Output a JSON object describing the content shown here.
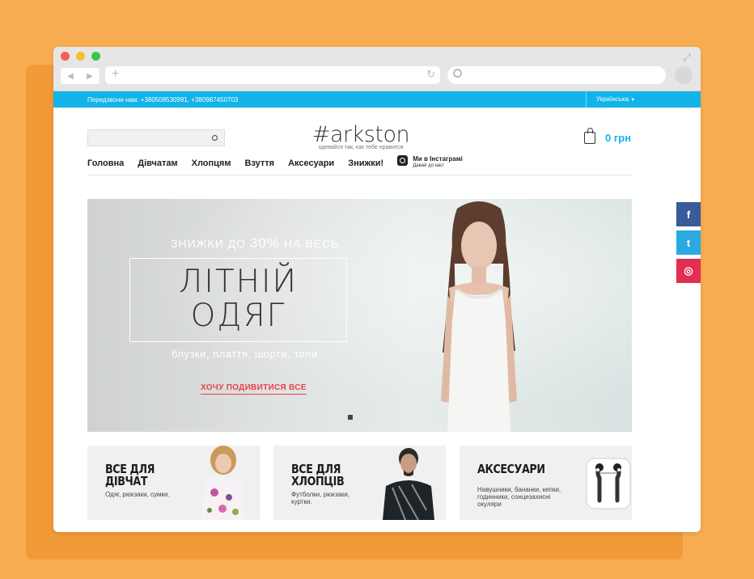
{
  "browser": {
    "url": "",
    "search_placeholder": ""
  },
  "topbar": {
    "phones": "Передзвони нам: +380508530991, +380987450703",
    "language": "Українська"
  },
  "header": {
    "search_placeholder": "",
    "logo_text": "#arkston",
    "tagline": "одевайся так, как тебе нравится",
    "cart_total": "0 грн"
  },
  "nav": {
    "items": [
      "Головна",
      "Дівчатам",
      "Хлопцям",
      "Взуття",
      "Аксесуари",
      "Знижки!"
    ],
    "instagram_title": "Ми в Інстаграмі",
    "instagram_sub": "Давай до нас!"
  },
  "hero": {
    "promo_prefix": "ЗНИЖКИ ДО",
    "promo_percent": "30%",
    "promo_suffix": "НА ВЕСЬ",
    "headline_line1": "ЛІТНІЙ",
    "headline_line2": "ОДЯГ",
    "subline": "блузки, плаття, шорти, топи",
    "cta": "ХОЧУ ПОДИВИТИСЯ ВСЕ"
  },
  "social": {
    "facebook": "f",
    "twitter": "t",
    "instagram": "◎"
  },
  "cards": [
    {
      "title": "ВСЕ ДЛЯ ДІВЧАТ",
      "desc": "Одяг, рюкзаки, сумки."
    },
    {
      "title": "ВСЕ ДЛЯ ХЛОПЦІВ",
      "desc": "Футболки, рюкзаки, куртки."
    },
    {
      "title": "АКСЕСУАРИ",
      "desc": "Навушники, бананки, кепки, годинники, сонцезахисні окуляри"
    }
  ],
  "colors": {
    "background": "#f8ad52",
    "accent": "#12b3e8",
    "cta": "#e8434a",
    "facebook": "#3b5a9a",
    "twitter": "#29aae1",
    "instagram": "#e02f50"
  }
}
